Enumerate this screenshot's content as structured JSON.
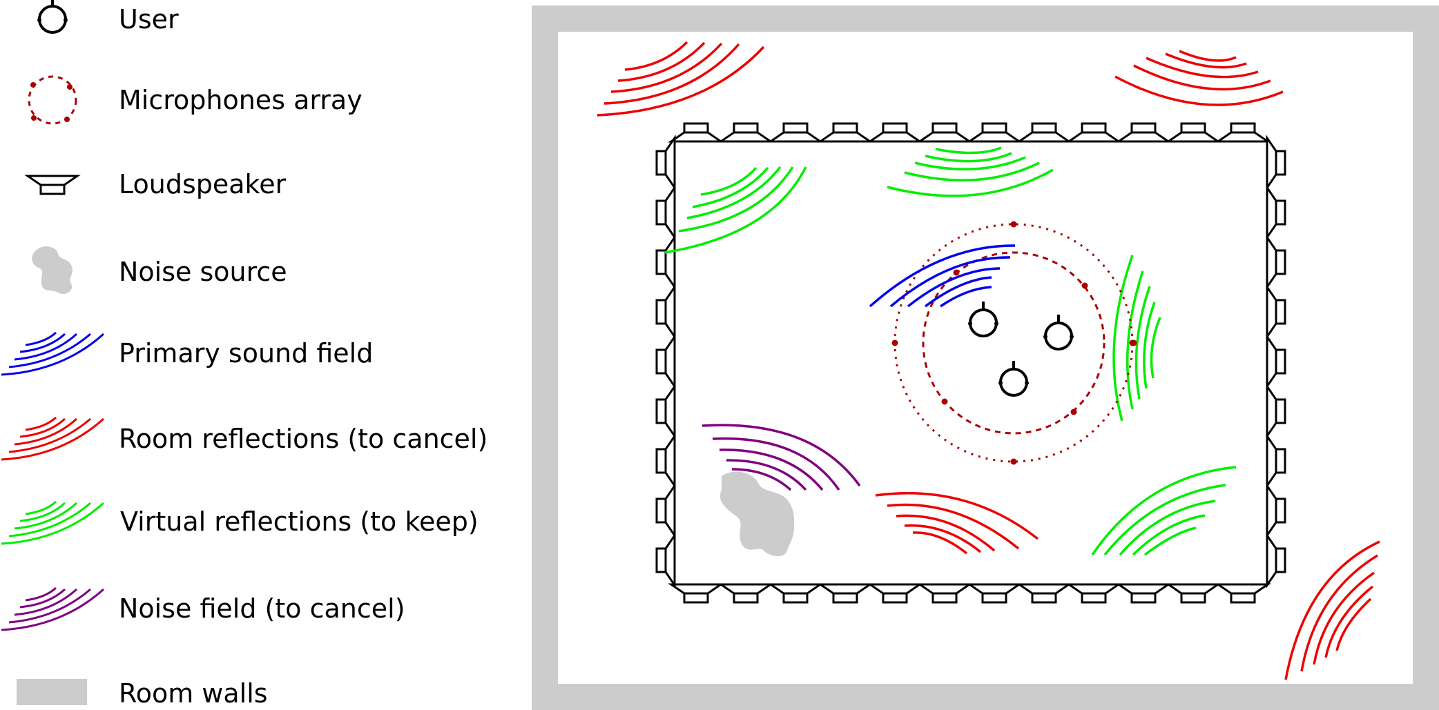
{
  "legend": {
    "items": [
      {
        "key": "user",
        "label": "User",
        "icon": "user-icon"
      },
      {
        "key": "microphones",
        "label": "Microphones array",
        "icon": "microphone-array-icon"
      },
      {
        "key": "loudspeaker",
        "label": "Loudspeaker",
        "icon": "loudspeaker-icon"
      },
      {
        "key": "noise_source",
        "label": "Noise source",
        "icon": "noise-source-icon"
      },
      {
        "key": "primary",
        "label": "Primary sound field",
        "icon": "primary-wave-icon"
      },
      {
        "key": "room_reflections",
        "label": "Room reflections (to cancel)",
        "icon": "room-reflection-wave-icon"
      },
      {
        "key": "virtual_reflections",
        "label": "Virtual reflections (to keep)",
        "icon": "virtual-reflection-wave-icon"
      },
      {
        "key": "noise_field",
        "label": "Noise field (to cancel)",
        "icon": "noise-field-wave-icon"
      },
      {
        "key": "walls",
        "label": "Room walls",
        "icon": "room-walls-swatch"
      }
    ]
  },
  "colors": {
    "primary": "#0000ee",
    "room_reflections": "#ee0000",
    "virtual_reflections": "#00ee00",
    "noise_field": "#800080",
    "microphones": "#aa0000",
    "walls": "#cccccc",
    "noise_source": "#cccccc",
    "outline": "#000000"
  }
}
